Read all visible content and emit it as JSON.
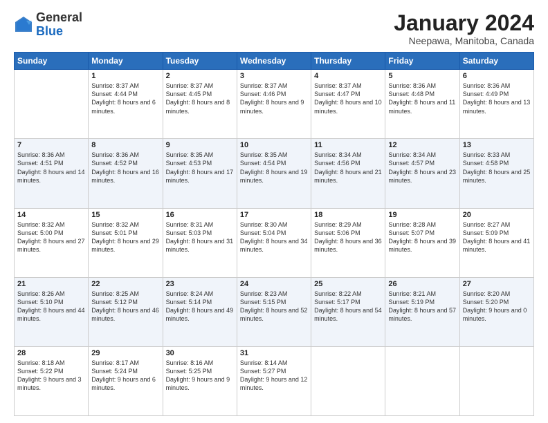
{
  "header": {
    "logo_general": "General",
    "logo_blue": "Blue",
    "month_title": "January 2024",
    "location": "Neepawa, Manitoba, Canada"
  },
  "days_of_week": [
    "Sunday",
    "Monday",
    "Tuesday",
    "Wednesday",
    "Thursday",
    "Friday",
    "Saturday"
  ],
  "weeks": [
    [
      {
        "day": "",
        "sunrise": "",
        "sunset": "",
        "daylight": ""
      },
      {
        "day": "1",
        "sunrise": "Sunrise: 8:37 AM",
        "sunset": "Sunset: 4:44 PM",
        "daylight": "Daylight: 8 hours and 6 minutes."
      },
      {
        "day": "2",
        "sunrise": "Sunrise: 8:37 AM",
        "sunset": "Sunset: 4:45 PM",
        "daylight": "Daylight: 8 hours and 8 minutes."
      },
      {
        "day": "3",
        "sunrise": "Sunrise: 8:37 AM",
        "sunset": "Sunset: 4:46 PM",
        "daylight": "Daylight: 8 hours and 9 minutes."
      },
      {
        "day": "4",
        "sunrise": "Sunrise: 8:37 AM",
        "sunset": "Sunset: 4:47 PM",
        "daylight": "Daylight: 8 hours and 10 minutes."
      },
      {
        "day": "5",
        "sunrise": "Sunrise: 8:36 AM",
        "sunset": "Sunset: 4:48 PM",
        "daylight": "Daylight: 8 hours and 11 minutes."
      },
      {
        "day": "6",
        "sunrise": "Sunrise: 8:36 AM",
        "sunset": "Sunset: 4:49 PM",
        "daylight": "Daylight: 8 hours and 13 minutes."
      }
    ],
    [
      {
        "day": "7",
        "sunrise": "Sunrise: 8:36 AM",
        "sunset": "Sunset: 4:51 PM",
        "daylight": "Daylight: 8 hours and 14 minutes."
      },
      {
        "day": "8",
        "sunrise": "Sunrise: 8:36 AM",
        "sunset": "Sunset: 4:52 PM",
        "daylight": "Daylight: 8 hours and 16 minutes."
      },
      {
        "day": "9",
        "sunrise": "Sunrise: 8:35 AM",
        "sunset": "Sunset: 4:53 PM",
        "daylight": "Daylight: 8 hours and 17 minutes."
      },
      {
        "day": "10",
        "sunrise": "Sunrise: 8:35 AM",
        "sunset": "Sunset: 4:54 PM",
        "daylight": "Daylight: 8 hours and 19 minutes."
      },
      {
        "day": "11",
        "sunrise": "Sunrise: 8:34 AM",
        "sunset": "Sunset: 4:56 PM",
        "daylight": "Daylight: 8 hours and 21 minutes."
      },
      {
        "day": "12",
        "sunrise": "Sunrise: 8:34 AM",
        "sunset": "Sunset: 4:57 PM",
        "daylight": "Daylight: 8 hours and 23 minutes."
      },
      {
        "day": "13",
        "sunrise": "Sunrise: 8:33 AM",
        "sunset": "Sunset: 4:58 PM",
        "daylight": "Daylight: 8 hours and 25 minutes."
      }
    ],
    [
      {
        "day": "14",
        "sunrise": "Sunrise: 8:32 AM",
        "sunset": "Sunset: 5:00 PM",
        "daylight": "Daylight: 8 hours and 27 minutes."
      },
      {
        "day": "15",
        "sunrise": "Sunrise: 8:32 AM",
        "sunset": "Sunset: 5:01 PM",
        "daylight": "Daylight: 8 hours and 29 minutes."
      },
      {
        "day": "16",
        "sunrise": "Sunrise: 8:31 AM",
        "sunset": "Sunset: 5:03 PM",
        "daylight": "Daylight: 8 hours and 31 minutes."
      },
      {
        "day": "17",
        "sunrise": "Sunrise: 8:30 AM",
        "sunset": "Sunset: 5:04 PM",
        "daylight": "Daylight: 8 hours and 34 minutes."
      },
      {
        "day": "18",
        "sunrise": "Sunrise: 8:29 AM",
        "sunset": "Sunset: 5:06 PM",
        "daylight": "Daylight: 8 hours and 36 minutes."
      },
      {
        "day": "19",
        "sunrise": "Sunrise: 8:28 AM",
        "sunset": "Sunset: 5:07 PM",
        "daylight": "Daylight: 8 hours and 39 minutes."
      },
      {
        "day": "20",
        "sunrise": "Sunrise: 8:27 AM",
        "sunset": "Sunset: 5:09 PM",
        "daylight": "Daylight: 8 hours and 41 minutes."
      }
    ],
    [
      {
        "day": "21",
        "sunrise": "Sunrise: 8:26 AM",
        "sunset": "Sunset: 5:10 PM",
        "daylight": "Daylight: 8 hours and 44 minutes."
      },
      {
        "day": "22",
        "sunrise": "Sunrise: 8:25 AM",
        "sunset": "Sunset: 5:12 PM",
        "daylight": "Daylight: 8 hours and 46 minutes."
      },
      {
        "day": "23",
        "sunrise": "Sunrise: 8:24 AM",
        "sunset": "Sunset: 5:14 PM",
        "daylight": "Daylight: 8 hours and 49 minutes."
      },
      {
        "day": "24",
        "sunrise": "Sunrise: 8:23 AM",
        "sunset": "Sunset: 5:15 PM",
        "daylight": "Daylight: 8 hours and 52 minutes."
      },
      {
        "day": "25",
        "sunrise": "Sunrise: 8:22 AM",
        "sunset": "Sunset: 5:17 PM",
        "daylight": "Daylight: 8 hours and 54 minutes."
      },
      {
        "day": "26",
        "sunrise": "Sunrise: 8:21 AM",
        "sunset": "Sunset: 5:19 PM",
        "daylight": "Daylight: 8 hours and 57 minutes."
      },
      {
        "day": "27",
        "sunrise": "Sunrise: 8:20 AM",
        "sunset": "Sunset: 5:20 PM",
        "daylight": "Daylight: 9 hours and 0 minutes."
      }
    ],
    [
      {
        "day": "28",
        "sunrise": "Sunrise: 8:18 AM",
        "sunset": "Sunset: 5:22 PM",
        "daylight": "Daylight: 9 hours and 3 minutes."
      },
      {
        "day": "29",
        "sunrise": "Sunrise: 8:17 AM",
        "sunset": "Sunset: 5:24 PM",
        "daylight": "Daylight: 9 hours and 6 minutes."
      },
      {
        "day": "30",
        "sunrise": "Sunrise: 8:16 AM",
        "sunset": "Sunset: 5:25 PM",
        "daylight": "Daylight: 9 hours and 9 minutes."
      },
      {
        "day": "31",
        "sunrise": "Sunrise: 8:14 AM",
        "sunset": "Sunset: 5:27 PM",
        "daylight": "Daylight: 9 hours and 12 minutes."
      },
      {
        "day": "",
        "sunrise": "",
        "sunset": "",
        "daylight": ""
      },
      {
        "day": "",
        "sunrise": "",
        "sunset": "",
        "daylight": ""
      },
      {
        "day": "",
        "sunrise": "",
        "sunset": "",
        "daylight": ""
      }
    ]
  ]
}
